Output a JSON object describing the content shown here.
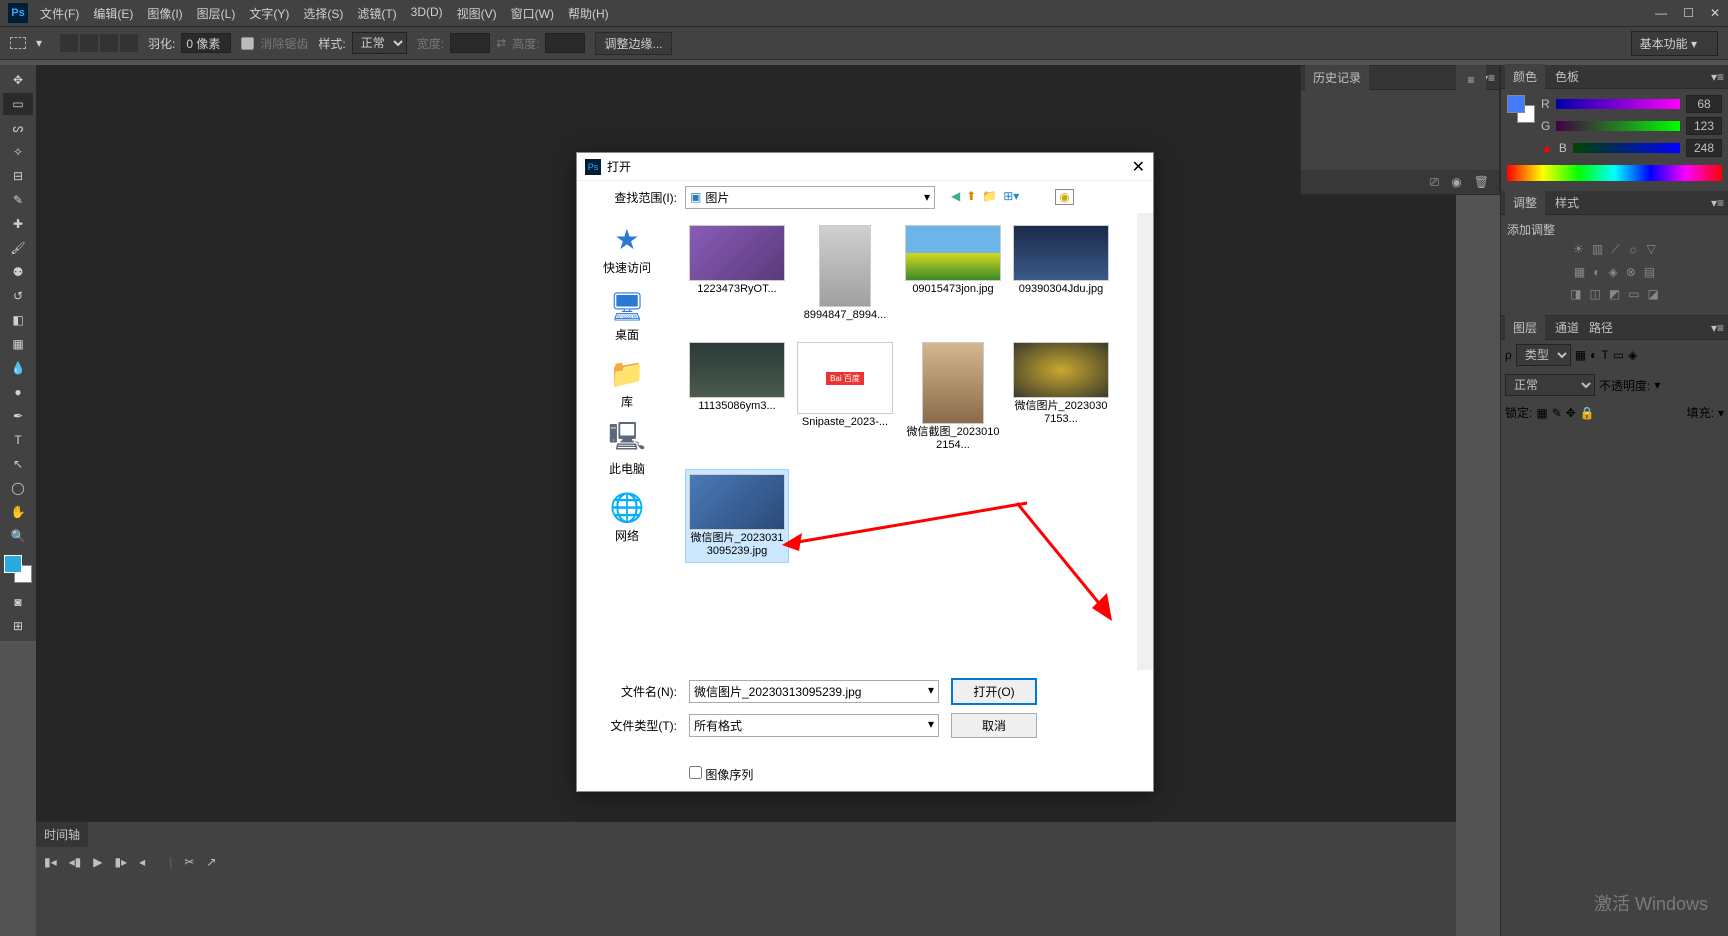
{
  "app": {
    "logo": "Ps"
  },
  "menu": {
    "file": "文件(F)",
    "edit": "编辑(E)",
    "image": "图像(I)",
    "layer": "图层(L)",
    "type": "文字(Y)",
    "select": "选择(S)",
    "filter": "滤镜(T)",
    "threed": "3D(D)",
    "view": "视图(V)",
    "window": "窗口(W)",
    "help": "帮助(H)"
  },
  "options": {
    "feather_label": "羽化:",
    "feather_value": "0 像素",
    "antialias": "消除锯齿",
    "style_label": "样式:",
    "style_value": "正常",
    "width_label": "宽度:",
    "height_label": "高度:",
    "refine_edge": "调整边缘...",
    "workspace": "基本功能"
  },
  "history": {
    "title": "历史记录"
  },
  "color": {
    "tab_color": "颜色",
    "tab_swatches": "色板",
    "r_label": "R",
    "r_val": "68",
    "g_label": "G",
    "g_val": "123",
    "b_label": "B",
    "b_val": "248"
  },
  "adjust": {
    "tab_adjust": "调整",
    "tab_style": "样式",
    "add_adjust": "添加调整"
  },
  "layers": {
    "tab_layers": "图层",
    "tab_channels": "通道",
    "tab_paths": "路径",
    "kind": "类型",
    "blend": "正常",
    "opacity_label": "不透明度:",
    "lock_label": "锁定:",
    "fill_label": "填充:"
  },
  "timeline": {
    "title": "时间轴"
  },
  "dialog": {
    "title": "打开",
    "lookin_label": "查找范围(I):",
    "lookin_value": "图片",
    "sidebar": {
      "quick": "快速访问",
      "desktop": "桌面",
      "libs": "库",
      "thispc": "此电脑",
      "network": "网络"
    },
    "files": [
      {
        "name": "1223473RyOT..."
      },
      {
        "name": "8994847_8994..."
      },
      {
        "name": "09015473jon.jpg"
      },
      {
        "name": "09390304Jdu.jpg"
      },
      {
        "name": "11135086ym3..."
      },
      {
        "name": "Snipaste_2023-..."
      },
      {
        "name": "微信截图_20230102154..."
      },
      {
        "name": "微信图片_20230307153..."
      },
      {
        "name": "微信图片_20230313095239.jpg"
      }
    ],
    "filename_label": "文件名(N):",
    "filename_value": "微信图片_20230313095239.jpg",
    "filetype_label": "文件类型(T):",
    "filetype_value": "所有格式",
    "open_btn": "打开(O)",
    "cancel_btn": "取消",
    "image_seq": "图像序列"
  },
  "watermark": "激活 Windows"
}
